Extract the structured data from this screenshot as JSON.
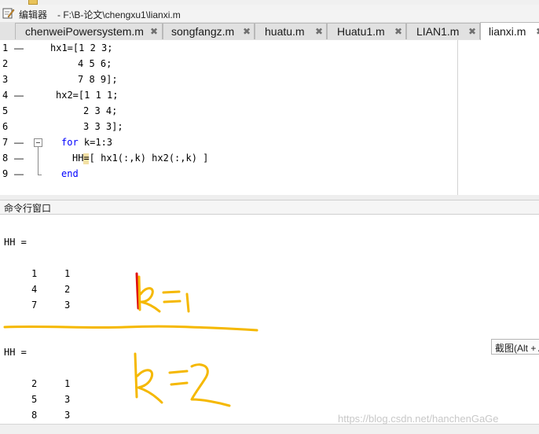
{
  "window": {
    "title_label": "编辑器",
    "title_path": "- F:\\B-论文\\chengxu1\\lianxi.m"
  },
  "tabs": [
    {
      "label": "chenweiPowersystem.m",
      "close": "✖"
    },
    {
      "label": "songfangz.m",
      "close": "✖"
    },
    {
      "label": "huatu.m",
      "close": "✖"
    },
    {
      "label": "Huatu1.m",
      "close": "✖"
    },
    {
      "label": "LIAN1.m",
      "close": "✖"
    },
    {
      "label": "lianxi.m",
      "close": "✖"
    }
  ],
  "editor": {
    "lines": [
      {
        "num": "1",
        "dash": "—",
        "text": "hx1=[1 2 3;"
      },
      {
        "num": "2",
        "dash": "",
        "text": "4 5 6;"
      },
      {
        "num": "3",
        "dash": "",
        "text": "7 8 9];"
      },
      {
        "num": "4",
        "dash": "—",
        "text": "hx2=[1 1 1;"
      },
      {
        "num": "5",
        "dash": "",
        "text": "2 3 4;"
      },
      {
        "num": "6",
        "dash": "",
        "text": "3 3 3];"
      },
      {
        "num": "7",
        "dash": "—",
        "kw": "for",
        "text": " k=1:3"
      },
      {
        "num": "8",
        "dash": "—",
        "text": "HH=[ hx1(:,k) hx2(:,k) ]"
      },
      {
        "num": "9",
        "dash": "—",
        "kw": "end",
        "text": ""
      }
    ]
  },
  "command_window": {
    "title": "命令行窗口",
    "blocks": [
      {
        "header": "HH =",
        "rows": [
          [
            "1",
            "1"
          ],
          [
            "4",
            "2"
          ],
          [
            "7",
            "3"
          ]
        ]
      },
      {
        "header": "HH =",
        "rows": [
          [
            "2",
            "1"
          ],
          [
            "5",
            "3"
          ],
          [
            "8",
            "3"
          ]
        ]
      }
    ]
  },
  "tooltip": {
    "text": "截图(Alt + A)"
  },
  "watermark": "https://blog.csdn.net/hanchenGaGe",
  "colors": {
    "keyword": "#0000ff",
    "annotation_yellow": "#f5b800",
    "annotation_red": "#e01010"
  }
}
